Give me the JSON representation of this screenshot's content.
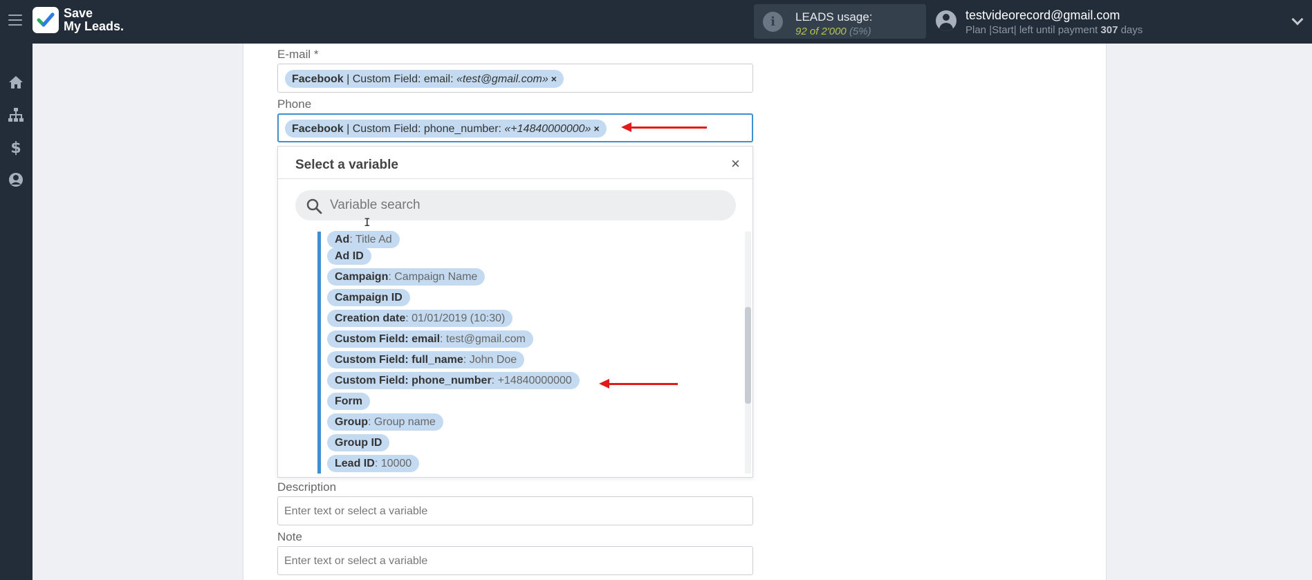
{
  "app": {
    "logo_line1": "Save",
    "logo_line2": "My Leads."
  },
  "leads": {
    "title": "LEADS usage:",
    "count": "92 of 2'000",
    "percent": "(5%)"
  },
  "user": {
    "email": "testvideorecord@gmail.com",
    "plan_prefix": "Plan |Start| left until payment ",
    "days_count": "307",
    "days_suffix": " days"
  },
  "sidebar": [
    "home-icon",
    "sitemap-icon",
    "dollar-icon",
    "account-icon"
  ],
  "fields": {
    "email": {
      "label": "E-mail *",
      "tag": {
        "source": "Facebook",
        "field": " | Custom Field: email: ",
        "value": "«test@gmail.com»",
        "remove": "×"
      }
    },
    "phone": {
      "label": "Phone",
      "tag": {
        "source": "Facebook",
        "field": " | Custom Field: phone_number: ",
        "value": "«+14840000000»",
        "remove": "×"
      }
    },
    "description": {
      "label": "Description",
      "placeholder": "Enter text or select a variable"
    },
    "note": {
      "label": "Note",
      "placeholder": "Enter text or select a variable"
    }
  },
  "dropdown": {
    "title": "Select a variable",
    "close": "×",
    "search_placeholder": "Variable search",
    "items": [
      {
        "name": "Ad",
        "value": ": Title Ad"
      },
      {
        "name": "Ad ID",
        "value": ""
      },
      {
        "name": "Campaign",
        "value": ": Campaign Name"
      },
      {
        "name": "Campaign ID",
        "value": ""
      },
      {
        "name": "Creation date",
        "value": ": 01/01/2019 (10:30)"
      },
      {
        "name": "Custom Field: email",
        "value": ": test@gmail.com"
      },
      {
        "name": "Custom Field: full_name",
        "value": ": John Doe"
      },
      {
        "name": "Custom Field: phone_number",
        "value": ": +14840000000"
      },
      {
        "name": "Form",
        "value": ""
      },
      {
        "name": "Group",
        "value": ": Group name"
      },
      {
        "name": "Group ID",
        "value": ""
      },
      {
        "name": "Lead ID",
        "value": ": 10000"
      }
    ]
  },
  "colors": {
    "accent": "#3d8fd0",
    "arrow": "#e21a1a",
    "tag_bg": "#c4daf0",
    "topbar": "#232d3a"
  }
}
